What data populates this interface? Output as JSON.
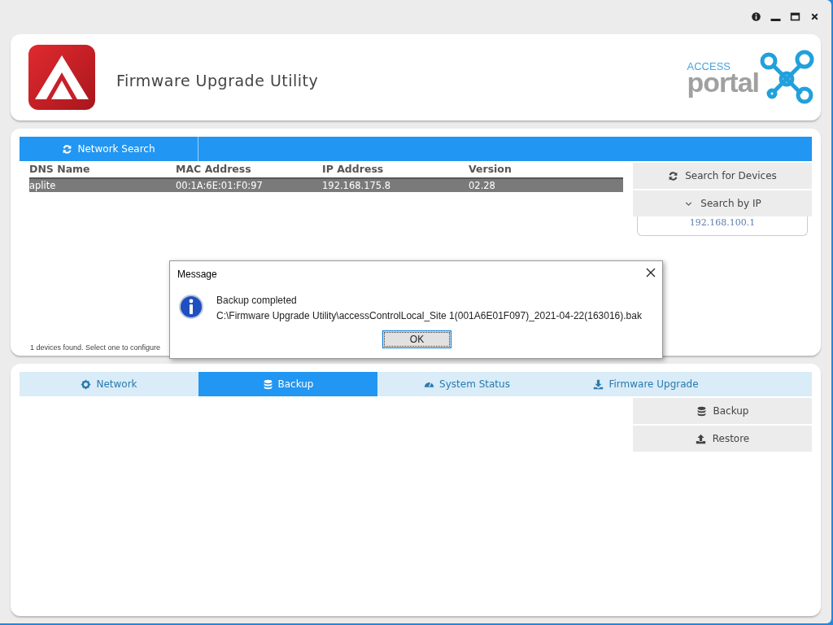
{
  "window": {
    "controls": [
      {
        "kind": "info"
      },
      {
        "kind": "minimize"
      },
      {
        "kind": "maximize"
      },
      {
        "kind": "close"
      }
    ]
  },
  "header": {
    "title": "Firmware Upgrade Utility",
    "brand": {
      "top": "ACCESS",
      "bottom": "portal"
    }
  },
  "search_tabs": [
    {
      "label": "Network Search",
      "selected": true
    }
  ],
  "devices": {
    "columns": [
      "DNS Name",
      "MAC Address",
      "IP Address",
      "Version"
    ],
    "rows": [
      {
        "cells": [
          "aplite",
          "00:1A:6E:01:F0:97",
          "192.168.175.8",
          "02.28"
        ],
        "selected": true
      }
    ],
    "status": "1 devices found. Select one to configure"
  },
  "search_actions": [
    {
      "label": "Search for Devices"
    },
    {
      "label": "Search by IP"
    }
  ],
  "ip_field": {
    "value": "192.168.100.1"
  },
  "tabs": [
    {
      "label": "Network",
      "selected": false
    },
    {
      "label": "Backup",
      "selected": true
    },
    {
      "label": "System Status",
      "selected": false
    },
    {
      "label": "Firmware Upgrade",
      "selected": false
    }
  ],
  "backup_actions": [
    {
      "label": "Backup"
    },
    {
      "label": "Restore"
    }
  ],
  "dialog": {
    "title": "Message",
    "lines": [
      "Backup completed",
      "C:\\Firmware Upgrade Utility\\accessControlLocal_Site 1(001A6E01F097)_2021-04-22(163016).bak"
    ],
    "button": "OK"
  }
}
